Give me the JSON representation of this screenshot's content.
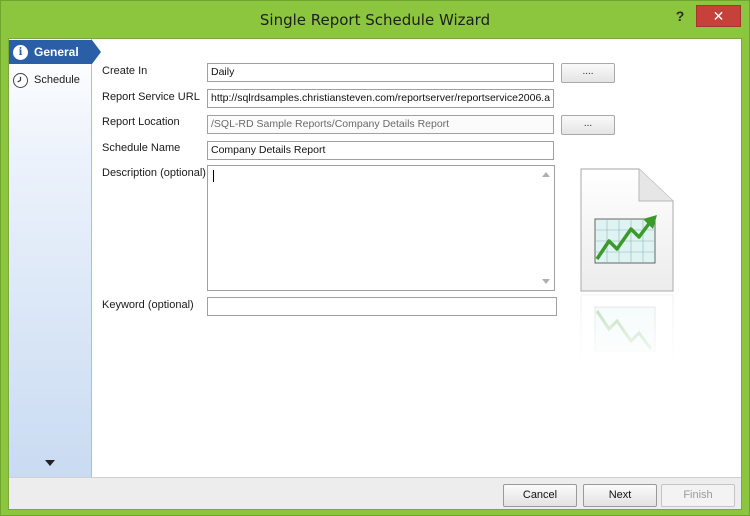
{
  "window": {
    "title": "Single Report Schedule Wizard",
    "help_label": "?",
    "close_label": "✕"
  },
  "sidebar": {
    "items": [
      {
        "label": "General",
        "icon": "info-icon",
        "selected": true
      },
      {
        "label": "Schedule",
        "icon": "clock-icon",
        "selected": false
      }
    ]
  },
  "form": {
    "create_in": {
      "label": "Create In",
      "value": "Daily",
      "browse_label": "...."
    },
    "report_service_url": {
      "label": "Report  Service URL",
      "value": "http://sqlrdsamples.christiansteven.com/reportserver/reportservice2006.a"
    },
    "report_location": {
      "label": "Report Location",
      "value": "/SQL-RD Sample Reports/Company Details Report",
      "browse_label": "..."
    },
    "schedule_name": {
      "label": "Schedule Name",
      "value": "Company Details Report"
    },
    "description": {
      "label": "Description (optional)",
      "value": ""
    },
    "keyword": {
      "label": "Keyword (optional)",
      "value": ""
    }
  },
  "footer": {
    "cancel_label": "Cancel",
    "next_label": "Next",
    "finish_label": "Finish"
  },
  "colors": {
    "frame": "#8cc63f",
    "selected_nav": "#2a5fa8",
    "close_button": "#c7413b",
    "chart_arrow": "#3a9a2a"
  }
}
